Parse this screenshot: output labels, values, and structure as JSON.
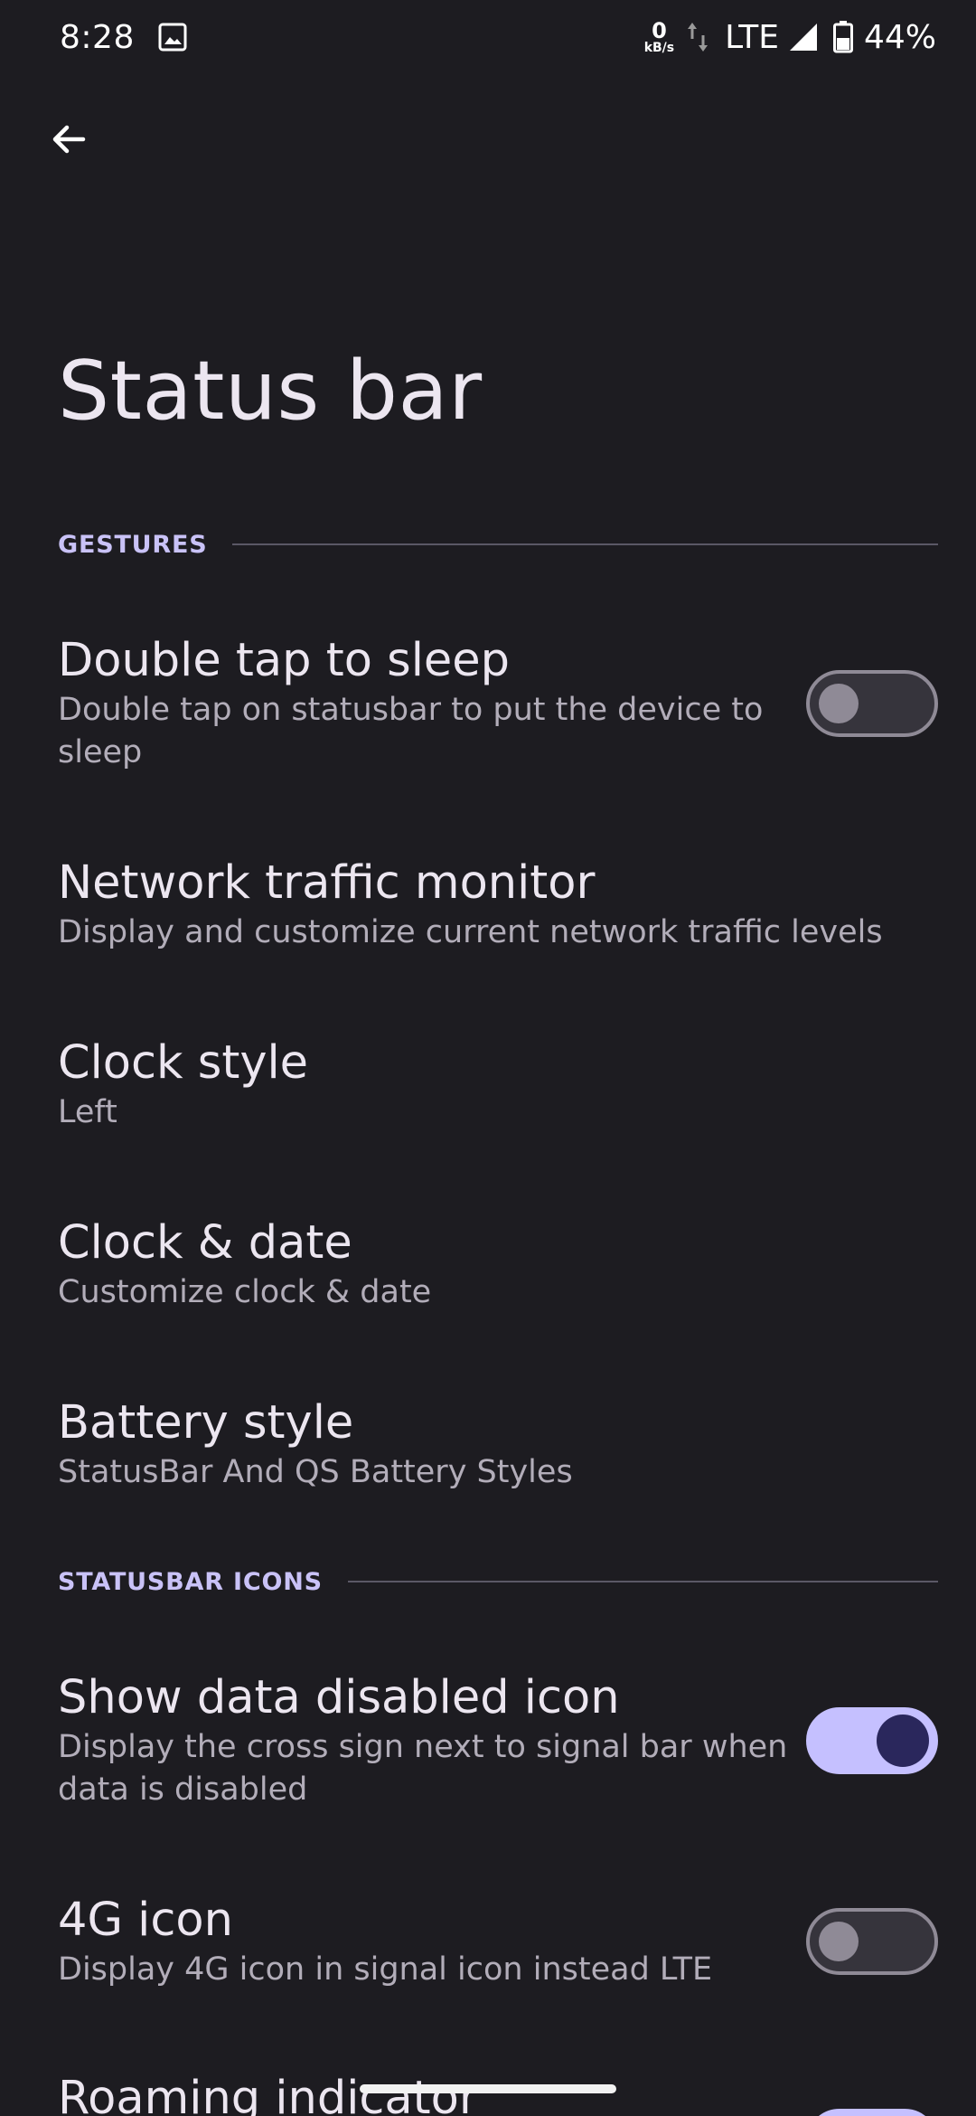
{
  "status_bar": {
    "time": "8:28",
    "net_speed_value": "0",
    "net_speed_unit": "kB/s",
    "network": "LTE",
    "battery": "44%",
    "icons": [
      "gallery-icon",
      "data-arrows-icon",
      "signal-icon",
      "battery-icon"
    ]
  },
  "header": {
    "back_icon": "arrow-back-icon",
    "title": "Status bar"
  },
  "sections": {
    "gestures": "GESTURES",
    "statusbar_icons": "STATUSBAR ICONS"
  },
  "prefs": {
    "double_tap": {
      "title": "Double tap to sleep",
      "summary": "Double tap on statusbar to put the device to sleep",
      "enabled": false
    },
    "network_traffic": {
      "title": "Network traffic monitor",
      "summary": "Display and customize current network traffic levels"
    },
    "clock_style": {
      "title": "Clock style",
      "summary": "Left"
    },
    "clock_date": {
      "title": "Clock & date",
      "summary": "Customize clock & date"
    },
    "battery_style": {
      "title": "Battery style",
      "summary": "StatusBar And QS Battery Styles"
    },
    "data_disabled": {
      "title": "Show data disabled icon",
      "summary": "Display the cross sign next to signal bar when data is disabled",
      "enabled": true
    },
    "four_g": {
      "title": "4G icon",
      "summary": "Display 4G icon in signal icon instead LTE",
      "enabled": false
    },
    "roaming": {
      "title": "Roaming indicator",
      "enabled": true
    }
  },
  "colors": {
    "background": "#1d1c21",
    "accent": "#c5c0ff",
    "section_label": "#c9c2f7",
    "toggle_off": "#8f8a96"
  }
}
